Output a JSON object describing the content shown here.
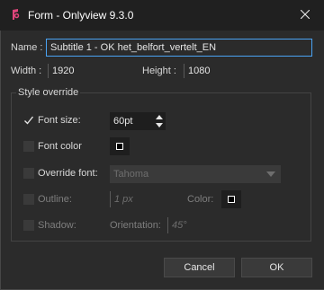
{
  "window": {
    "title": "Form - Onlyview  9.3.0"
  },
  "fields": {
    "name_label": "Name :",
    "name_value": "Subtitle 1 - OK het_belfort_vertelt_EN",
    "width_label": "Width :",
    "width_value": "1920",
    "height_label": "Height :",
    "height_value": "1080"
  },
  "style_override": {
    "title": "Style override",
    "font_size": {
      "label": "Font size:",
      "checked": true,
      "value": "60pt"
    },
    "font_color": {
      "label": "Font color",
      "checked": false,
      "swatch": "#000000"
    },
    "override_font": {
      "label": "Override font:",
      "checked": false,
      "value": "Tahoma"
    },
    "outline": {
      "label": "Outline:",
      "checked": false,
      "value": "1 px",
      "color_label": "Color:",
      "swatch": "#000000"
    },
    "shadow": {
      "label": "Shadow:",
      "checked": false,
      "orientation_label": "Orientation:",
      "orientation_value": "45°"
    }
  },
  "buttons": {
    "cancel": "Cancel",
    "ok": "OK"
  },
  "colors": {
    "accent": "#4aa3f3",
    "background": "#2b2b2b",
    "titlebar": "#202020"
  },
  "icons": {
    "app": "onlyview-logo-icon",
    "close": "close-icon",
    "check": "check-icon",
    "spin": "spin-arrows-icon",
    "dropdown": "chevron-down-icon"
  }
}
